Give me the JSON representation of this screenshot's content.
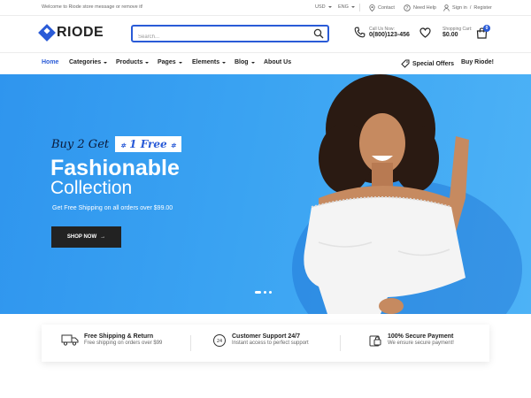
{
  "topbar": {
    "welcome": "Welcome to Riode store message or remove it!",
    "currency": "USD",
    "language": "ENG",
    "contact": "Contact",
    "help": "Need Help",
    "signin": "Sign in",
    "separator": "/",
    "register": "Register"
  },
  "header": {
    "logo": "RIODE",
    "search_placeholder": "Search...",
    "call_label": "Call Us Now:",
    "phone": "0(800)123-456",
    "cart_label": "Shopping Cart:",
    "cart_total": "$0.00",
    "cart_count": "0"
  },
  "nav": {
    "items": [
      {
        "label": "Home"
      },
      {
        "label": "Categories"
      },
      {
        "label": "Products"
      },
      {
        "label": "Pages"
      },
      {
        "label": "Elements"
      },
      {
        "label": "Blog"
      },
      {
        "label": "About Us"
      }
    ],
    "special_offers": "Special Offers",
    "buy_riode": "Buy Riode!"
  },
  "hero": {
    "promo_prefix": "Buy 2 Get",
    "promo_badge": "1 Free",
    "title": "Fashionable",
    "subtitle": "Collection",
    "shipping": "Get Free Shipping on all orders over $99.00",
    "button": "SHOP NOW",
    "slides": 3,
    "active_slide": 1
  },
  "services": [
    {
      "title": "Free Shipping & Return",
      "desc": "Free shipping on orders over $99",
      "icon": "truck-icon"
    },
    {
      "title": "Customer Support 24/7",
      "desc": "Instant access to perfect support",
      "icon": "support-24-icon"
    },
    {
      "title": "100% Secure Payment",
      "desc": "We ensure secure payment!",
      "icon": "secure-payment-icon"
    }
  ],
  "colors": {
    "accent": "#2a5bd7",
    "hero_bg": "#3aa3f2",
    "dark": "#222222"
  }
}
